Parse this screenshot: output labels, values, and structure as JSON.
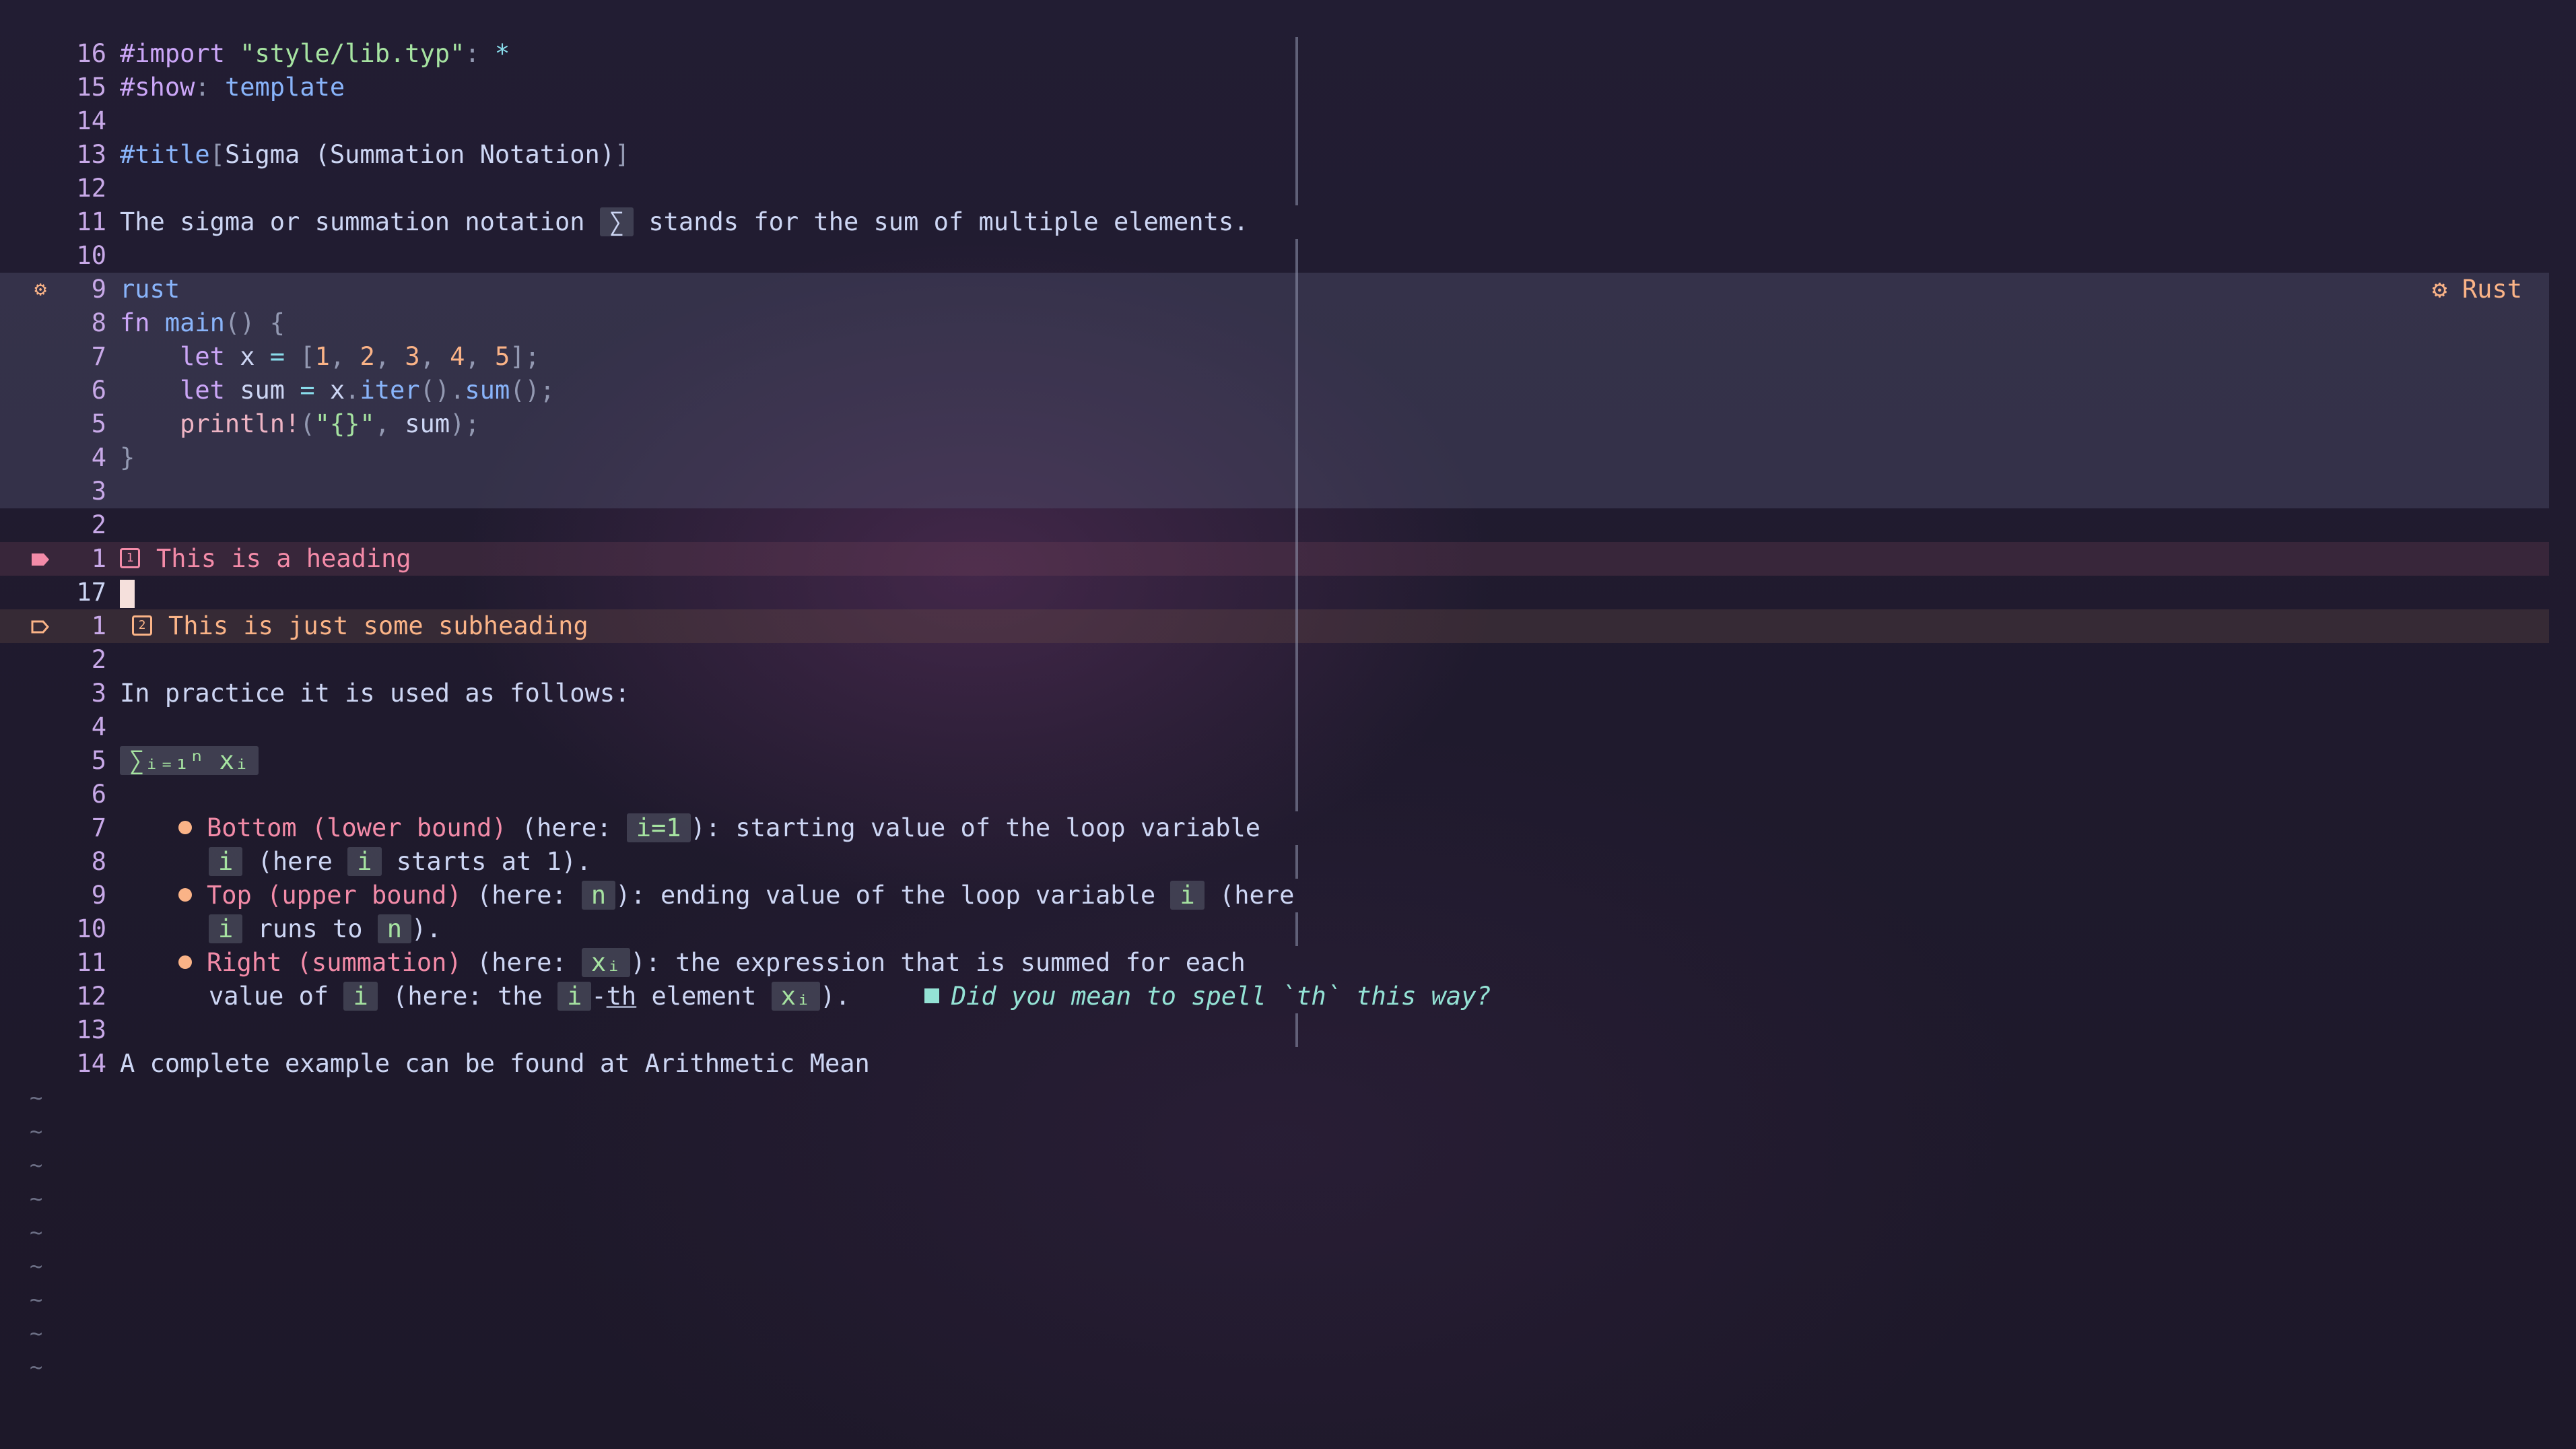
{
  "editor": {
    "lines": [
      {
        "num": "16",
        "segments": [
          {
            "t": "#import ",
            "c": "kw"
          },
          {
            "t": "\"style/lib.typ\"",
            "c": "str"
          },
          {
            "t": ": ",
            "c": "punct"
          },
          {
            "t": "*",
            "c": "op"
          }
        ]
      },
      {
        "num": "15",
        "segments": [
          {
            "t": "#show",
            "c": "kw"
          },
          {
            "t": ": ",
            "c": "punct"
          },
          {
            "t": "template",
            "c": "fn"
          }
        ]
      },
      {
        "num": "14",
        "segments": []
      },
      {
        "num": "13",
        "segments": [
          {
            "t": "#title",
            "c": "fn"
          },
          {
            "t": "[",
            "c": "punct"
          },
          {
            "t": "Sigma (Summation Notation)",
            "c": "plain"
          },
          {
            "t": "]",
            "c": "punct"
          }
        ]
      },
      {
        "num": "12",
        "segments": []
      },
      {
        "num": "11",
        "segments": [
          {
            "t": "The sigma or summation notation ",
            "c": "plain"
          },
          {
            "t": "∑",
            "c": "chip plainchip"
          },
          {
            "t": " stands for the sum of multiple elements.",
            "c": "plain"
          }
        ]
      },
      {
        "num": "10",
        "segments": []
      },
      {
        "num": "9",
        "bg": "codeblock-bg",
        "sign": "gear",
        "segments": [
          {
            "t": "rust",
            "c": "fn"
          }
        ],
        "lang": "Rust"
      },
      {
        "num": "8",
        "bg": "codeblock-bg",
        "segments": [
          {
            "t": "fn ",
            "c": "kw"
          },
          {
            "t": "main",
            "c": "fn"
          },
          {
            "t": "() {",
            "c": "punct"
          }
        ]
      },
      {
        "num": "7",
        "bg": "codeblock-bg",
        "segments": [
          {
            "t": "    let ",
            "c": "kw"
          },
          {
            "t": "x ",
            "c": "plain"
          },
          {
            "t": "= ",
            "c": "op"
          },
          {
            "t": "[",
            "c": "punct"
          },
          {
            "t": "1",
            "c": "num"
          },
          {
            "t": ", ",
            "c": "punct"
          },
          {
            "t": "2",
            "c": "num"
          },
          {
            "t": ", ",
            "c": "punct"
          },
          {
            "t": "3",
            "c": "num"
          },
          {
            "t": ", ",
            "c": "punct"
          },
          {
            "t": "4",
            "c": "num"
          },
          {
            "t": ", ",
            "c": "punct"
          },
          {
            "t": "5",
            "c": "num"
          },
          {
            "t": "];",
            "c": "punct"
          }
        ]
      },
      {
        "num": "6",
        "bg": "codeblock-bg",
        "segments": [
          {
            "t": "    let ",
            "c": "kw"
          },
          {
            "t": "sum ",
            "c": "plain"
          },
          {
            "t": "= ",
            "c": "op"
          },
          {
            "t": "x",
            "c": "plain"
          },
          {
            "t": ".",
            "c": "punct"
          },
          {
            "t": "iter",
            "c": "fn"
          },
          {
            "t": "().",
            "c": "punct"
          },
          {
            "t": "sum",
            "c": "fn"
          },
          {
            "t": "();",
            "c": "punct"
          }
        ]
      },
      {
        "num": "5",
        "bg": "codeblock-bg",
        "segments": [
          {
            "t": "    println!",
            "c": "macro"
          },
          {
            "t": "(",
            "c": "punct"
          },
          {
            "t": "\"{}\"",
            "c": "str"
          },
          {
            "t": ", ",
            "c": "punct"
          },
          {
            "t": "sum",
            "c": "plain"
          },
          {
            "t": ");",
            "c": "punct"
          }
        ]
      },
      {
        "num": "4",
        "bg": "codeblock-bg",
        "segments": [
          {
            "t": "}",
            "c": "punct"
          }
        ]
      },
      {
        "num": "3",
        "bg": "codeblock-bg",
        "segments": []
      },
      {
        "num": "2",
        "segments": []
      },
      {
        "num": "1",
        "bg": "h1-bg",
        "sign": "tag-filled",
        "heading": "1",
        "segments": [
          {
            "t": "This is a heading",
            "c": "h1text"
          }
        ]
      },
      {
        "num": "17",
        "current": true,
        "cursor": true,
        "segments": []
      },
      {
        "num": "1",
        "bg": "h2-bg",
        "sign": "tag-outline",
        "heading": "2",
        "segments": [
          {
            "t": "This is just some subheading",
            "c": "h2text"
          }
        ]
      },
      {
        "num": "2",
        "segments": []
      },
      {
        "num": "3",
        "segments": [
          {
            "t": "In practice it is used as follows:",
            "c": "plain"
          }
        ]
      },
      {
        "num": "4",
        "segments": []
      },
      {
        "num": "5",
        "segments": [
          {
            "t": "∑ᵢ₌₁ⁿ xᵢ",
            "c": "chip"
          }
        ]
      },
      {
        "num": "6",
        "segments": []
      },
      {
        "num": "7",
        "bullet": true,
        "segments": [
          {
            "t": "Bottom (lower bound)",
            "c": "strong"
          },
          {
            "t": " (here: ",
            "c": "plain"
          },
          {
            "t": "i=1",
            "c": "chip"
          },
          {
            "t": "): starting value of the loop variable",
            "c": "plain"
          }
        ]
      },
      {
        "num": "8",
        "indent": true,
        "segments": [
          {
            "t": "i",
            "c": "chip"
          },
          {
            "t": " (here ",
            "c": "plain"
          },
          {
            "t": "i",
            "c": "chip"
          },
          {
            "t": " starts at 1).",
            "c": "plain"
          }
        ]
      },
      {
        "num": "9",
        "bullet": true,
        "segments": [
          {
            "t": "Top (upper bound)",
            "c": "strong"
          },
          {
            "t": " (here: ",
            "c": "plain"
          },
          {
            "t": "n",
            "c": "chip"
          },
          {
            "t": "): ending value of the loop variable ",
            "c": "plain"
          },
          {
            "t": "i",
            "c": "chip"
          },
          {
            "t": " (here",
            "c": "plain"
          }
        ]
      },
      {
        "num": "10",
        "indent": true,
        "segments": [
          {
            "t": "i",
            "c": "chip"
          },
          {
            "t": " runs to ",
            "c": "plain"
          },
          {
            "t": "n",
            "c": "chip"
          },
          {
            "t": ").",
            "c": "plain"
          }
        ]
      },
      {
        "num": "11",
        "bullet": true,
        "segments": [
          {
            "t": "Right (summation)",
            "c": "strong"
          },
          {
            "t": " (here: ",
            "c": "plain"
          },
          {
            "t": "xᵢ",
            "c": "chip"
          },
          {
            "t": "): the expression that is summed for each",
            "c": "plain"
          }
        ]
      },
      {
        "num": "12",
        "indent": true,
        "segments": [
          {
            "t": "value of ",
            "c": "plain"
          },
          {
            "t": "i",
            "c": "chip"
          },
          {
            "t": " (here: the ",
            "c": "plain"
          },
          {
            "t": "i",
            "c": "chip"
          },
          {
            "t": "-",
            "c": "plain"
          },
          {
            "t": "th",
            "c": "plain underline"
          },
          {
            "t": " element ",
            "c": "plain"
          },
          {
            "t": "xᵢ",
            "c": "chip"
          },
          {
            "t": ").",
            "c": "plain"
          }
        ],
        "diagnostic": "Did you mean to spell `th` this way?"
      },
      {
        "num": "13",
        "segments": []
      },
      {
        "num": "14",
        "segments": [
          {
            "t": "A complete example can be found at Arithmetic Mean",
            "c": "plain"
          }
        ]
      }
    ],
    "tilde_count": 9,
    "tilde_char": "~"
  },
  "colors": {
    "background": "#1e1b2c",
    "line_number": "#c8a9e8",
    "keyword": "#cba6f7",
    "string": "#a6e3a1",
    "function": "#89b4fa",
    "number": "#fab387",
    "heading1": "#f38ba8",
    "heading2": "#fab387",
    "diagnostic": "#94e2d5"
  },
  "icons": {
    "code-lang": "gear-icon",
    "heading-marker-filled": "tag-filled-icon",
    "heading-marker-outline": "tag-outline-icon",
    "heading-level": "heading-level-icon",
    "list-bullet": "bullet-icon",
    "diagnostic-marker": "hint-square-icon"
  }
}
